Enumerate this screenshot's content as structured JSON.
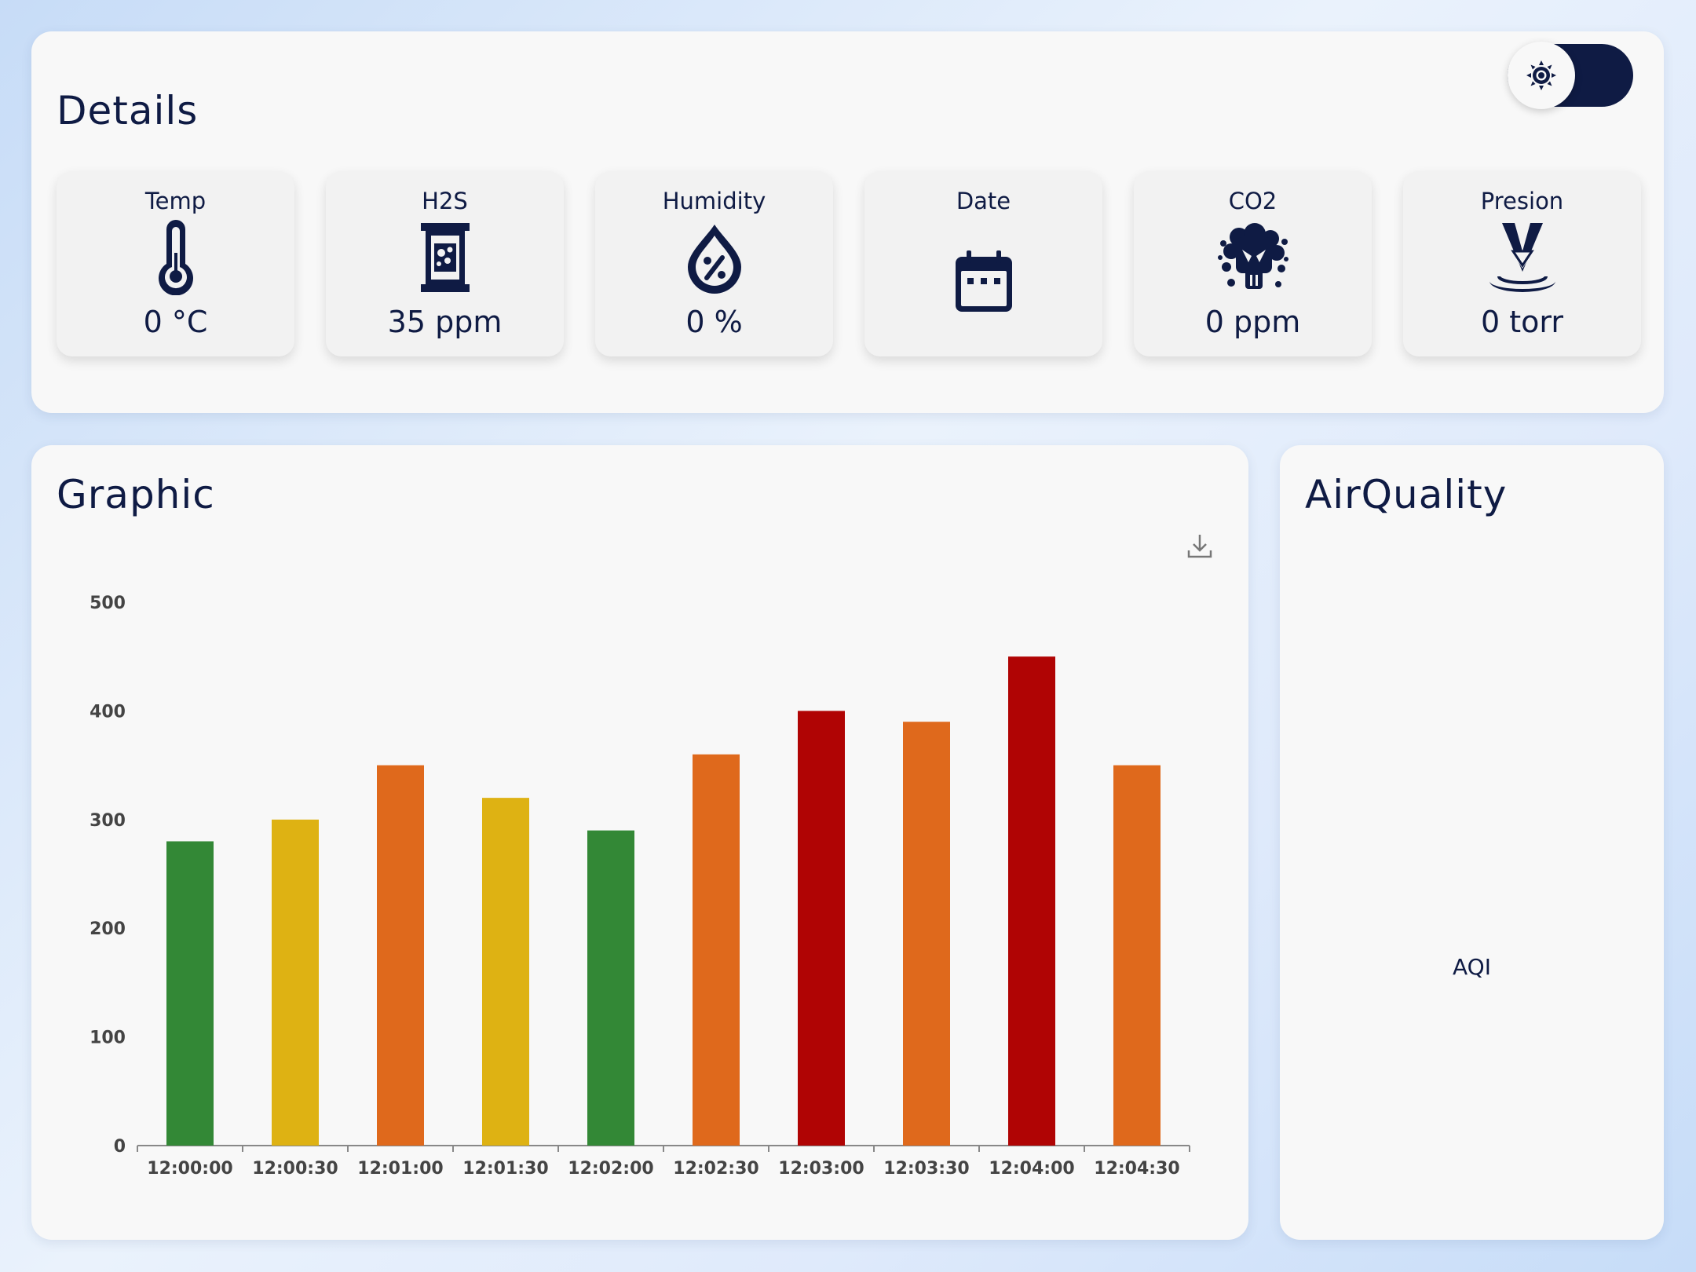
{
  "details": {
    "title": "Details",
    "toggle": {
      "icon": "sun-icon",
      "state": "dark"
    },
    "cards": [
      {
        "label": "Temp",
        "value": "0 °C",
        "icon": "thermometer-icon"
      },
      {
        "label": "H2S",
        "value": "35 ppm",
        "icon": "hourglass-icon"
      },
      {
        "label": "Humidity",
        "value": "0 %",
        "icon": "humidity-drop-icon"
      },
      {
        "label": "Date",
        "value": "",
        "icon": "calendar-icon"
      },
      {
        "label": "CO2",
        "value": "0 ppm",
        "icon": "co2-cloud-icon"
      },
      {
        "label": "Presion",
        "value": "0 torr",
        "icon": "pressure-icon"
      }
    ]
  },
  "graphic": {
    "title": "Graphic",
    "download_icon": "download-icon"
  },
  "airquality": {
    "title": "AirQuality",
    "label": "AQI"
  },
  "colors": {
    "navy": "#0f1b44",
    "good": "#338836",
    "moderate": "#deb213",
    "unhealthy": "#df691c",
    "hazardous": "#b00404"
  },
  "chart_data": {
    "type": "bar",
    "categories": [
      "12:00:00",
      "12:00:30",
      "12:01:00",
      "12:01:30",
      "12:02:00",
      "12:02:30",
      "12:03:00",
      "12:03:30",
      "12:04:00",
      "12:04:30"
    ],
    "values": [
      280,
      300,
      350,
      320,
      290,
      360,
      400,
      390,
      450,
      350
    ],
    "bar_colors": [
      "#338836",
      "#deb213",
      "#df691c",
      "#deb213",
      "#338836",
      "#df691c",
      "#b00404",
      "#df691c",
      "#b00404",
      "#df691c"
    ],
    "yticks": [
      0,
      100,
      200,
      300,
      400,
      500
    ],
    "ylim": [
      0,
      500
    ],
    "grid": false,
    "title": "",
    "xlabel": "",
    "ylabel": ""
  }
}
